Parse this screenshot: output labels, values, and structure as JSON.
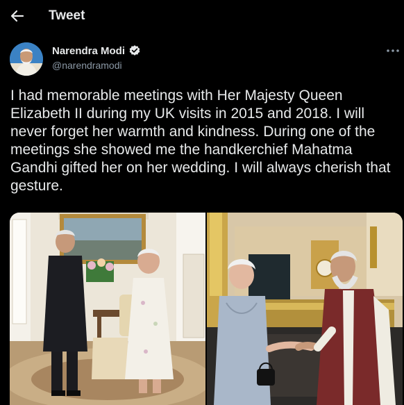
{
  "header": {
    "back_icon": "arrow-left-icon",
    "title": "Tweet"
  },
  "author": {
    "display_name": "Narendra Modi",
    "handle": "@narendramodi",
    "verified": true,
    "verified_color": "#1d9bf0"
  },
  "menu": {
    "icon": "more-horizontal-icon"
  },
  "tweet": {
    "text": "I had memorable meetings with Her Majesty Queen Elizabeth II during my UK visits in 2015 and 2018. I will never forget her warmth and kindness. During one of the meetings she showed me the handkerchief Mahatma Gandhi gifted her on her wedding. I will always cherish that gesture."
  },
  "media": {
    "count": 2
  },
  "colors": {
    "background": "#000000",
    "text": "#e7e9ea",
    "secondary_text": "#8b98a5"
  }
}
